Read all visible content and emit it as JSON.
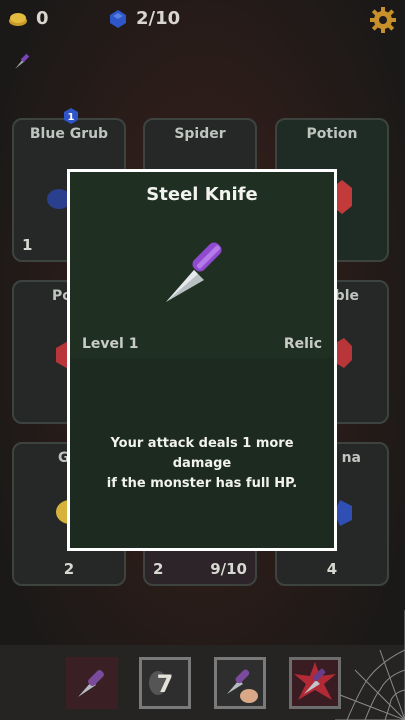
{
  "topbar": {
    "gold": "0",
    "gems": "2/10"
  },
  "grid": {
    "cards": [
      {
        "title": "Blue Grub",
        "left_num": "1",
        "right_num": ""
      },
      {
        "title": "Spider",
        "left_num": "",
        "right_num": ""
      },
      {
        "title": "Potion",
        "left_num": "",
        "right_num": ""
      },
      {
        "title": "Po",
        "left_num": "",
        "right_num": ""
      },
      {
        "title": "",
        "left_num": "",
        "right_num": ""
      },
      {
        "title": "ble",
        "left_num": "",
        "right_num": ""
      },
      {
        "title": "Ge",
        "left_num": "2",
        "right_num": ""
      },
      {
        "title": "",
        "left_num": "2",
        "right_num": "9/10"
      },
      {
        "title": "na",
        "left_num": "4",
        "right_num": ""
      }
    ],
    "badge_level": "1"
  },
  "modal": {
    "title": "Steel Knife",
    "level": "Level 1",
    "type": "Relic",
    "description_line1": "Your attack deals 1 more damage",
    "description_line2": "if the monster has full HP."
  },
  "bottombar": {
    "deck_count": "7"
  },
  "colors": {
    "modal_bg": "#1f3023",
    "modal_border": "#ffffff",
    "gold": "#d8b13a",
    "gem": "#2f56c9",
    "knife_handle": "#8b47c8"
  }
}
